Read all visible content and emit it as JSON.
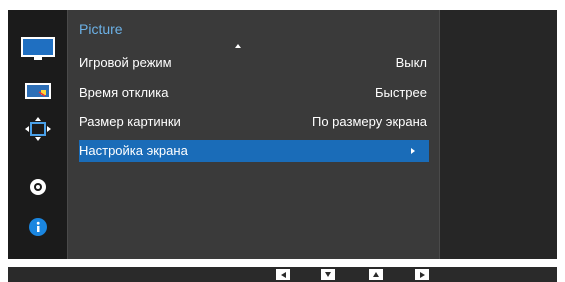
{
  "menu": {
    "title": "Picture",
    "items": [
      {
        "label": "Игровой режим",
        "value": "Выкл"
      },
      {
        "label": "Время отклика",
        "value": "Быстрее"
      },
      {
        "label": "Размер картинки",
        "value": "По размеру экрана"
      },
      {
        "label": "Настройка экрана",
        "value": ""
      }
    ],
    "selected_index": 3
  },
  "sidebar": {
    "icons": [
      "monitor-picture-icon",
      "color-icon",
      "resize-icon",
      "gear-icon",
      "info-icon"
    ],
    "selected_index": 0
  },
  "nav_buttons": [
    "arrow-left-icon",
    "arrow-down-icon",
    "arrow-up-icon",
    "arrow-right-icon"
  ],
  "colors": {
    "accent": "#1a6cb8",
    "title": "#6cb1e6",
    "panel": "#3a3a3a",
    "background": "#262626"
  }
}
